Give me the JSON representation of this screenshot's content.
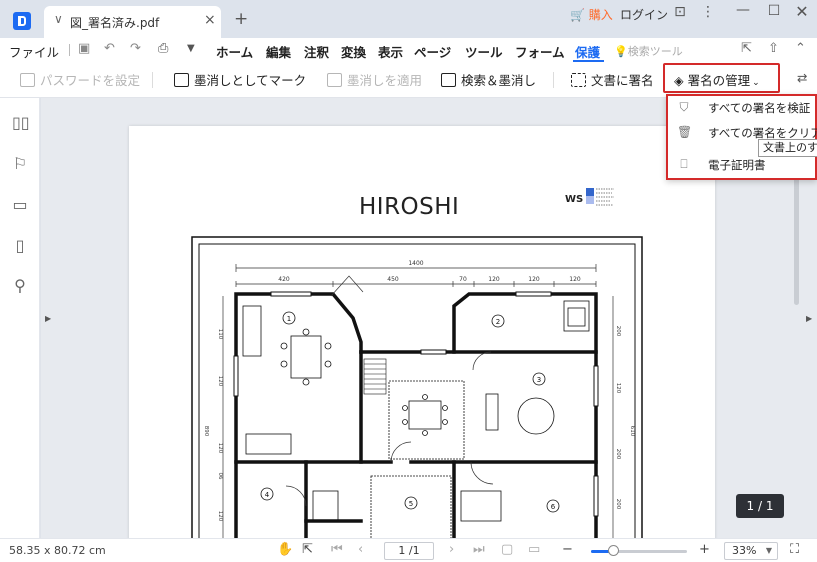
{
  "titlebar": {
    "tab_title": "図_署名済み.pdf",
    "buy_label": "購入",
    "login_label": "ログイン"
  },
  "ribbon": {
    "file_label": "ファイル",
    "menus": [
      "ホーム",
      "編集",
      "注釈",
      "変換",
      "表示",
      "ページ",
      "ツール",
      "フォーム",
      "保護"
    ],
    "active_menu": "保護",
    "search_tool_label": "検索ツール"
  },
  "toolbar": {
    "password_label": "パスワードを設定",
    "mark_redaction_label": "墨消しとしてマーク",
    "apply_redaction_label": "墨消しを適用",
    "search_redact_label": "検索＆墨消し",
    "sign_doc_label": "文書に署名",
    "manage_sig_label": "署名の管理"
  },
  "dropdown": {
    "items": [
      {
        "label": "すべての署名を検証",
        "icon": "shield-check-icon"
      },
      {
        "label": "すべての署名をクリア",
        "icon": "trash-icon"
      },
      {
        "label": "電子証明書",
        "icon": "certificate-icon"
      }
    ],
    "tooltip": "文書上のすべ"
  },
  "document": {
    "title": "HIROSHI",
    "logo_text": "WS",
    "dimensions": {
      "top_total": "1400",
      "top_parts": [
        "420",
        "450",
        "70",
        "120",
        "120",
        "120"
      ],
      "left_parts": [
        "110",
        "120",
        "890",
        "120",
        "06",
        "120"
      ],
      "right_parts": [
        "200",
        "120",
        "610",
        "200",
        "200"
      ]
    },
    "room_numbers": [
      "1",
      "2",
      "3",
      "4",
      "5",
      "6"
    ]
  },
  "status": {
    "dimensions_text": "58.35 x 80.72 cm",
    "page_field": "1 /1",
    "page_badge": "1 / 1",
    "zoom": "33%"
  },
  "colors": {
    "accent": "#1d6bf2",
    "highlight_border": "#d42a2a",
    "buy": "#ff6b2c"
  }
}
